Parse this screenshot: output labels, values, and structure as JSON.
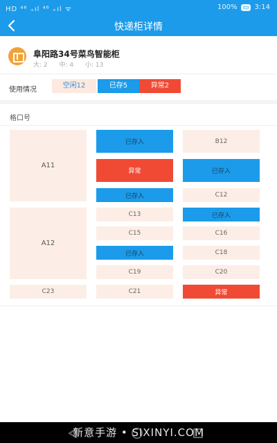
{
  "status_bar": {
    "left": "HD ⁴⁶ ₊ıl ⁴⁶ ₊ıl ᯤ",
    "battery": "100%",
    "time": "3:14"
  },
  "header": {
    "title": "快递柜详情",
    "back_icon": "chevron-left-icon"
  },
  "cabinet": {
    "icon": "cabinet-icon",
    "name": "阜阳路34号菜鸟智能柜",
    "size_large": "大: 2",
    "size_medium": "中: 4",
    "size_small": "小: 13"
  },
  "usage": {
    "label": "使用情况",
    "free": "空闲12",
    "stored": "已存5",
    "abnormal": "异常2"
  },
  "slots_header": "格口号",
  "slots": [
    {
      "label": "A11",
      "status": "free"
    },
    {
      "label": "已存入",
      "status": "stored"
    },
    {
      "label": "B12",
      "status": "free"
    },
    {
      "label": "异常",
      "status": "abnormal"
    },
    {
      "label": "已存入",
      "status": "stored"
    },
    {
      "label": "已存入",
      "status": "stored"
    },
    {
      "label": "C12",
      "status": "free"
    },
    {
      "label": "A12",
      "status": "free"
    },
    {
      "label": "C13",
      "status": "free"
    },
    {
      "label": "已存入",
      "status": "stored"
    },
    {
      "label": "C15",
      "status": "free"
    },
    {
      "label": "C16",
      "status": "free"
    },
    {
      "label": "已存入",
      "status": "stored"
    },
    {
      "label": "C18",
      "status": "free"
    },
    {
      "label": "C19",
      "status": "free"
    },
    {
      "label": "C20",
      "status": "free"
    },
    {
      "label": "C23",
      "status": "free"
    },
    {
      "label": "C21",
      "status": "free"
    },
    {
      "label": "异常",
      "status": "abnormal"
    }
  ],
  "colors": {
    "primary": "#1b9bea",
    "free": "#fceee6",
    "abnormal": "#f04a35",
    "accent": "#f0a23a"
  },
  "nav_bar": {
    "watermark": "新意手游 • SIXINYI.COM"
  }
}
